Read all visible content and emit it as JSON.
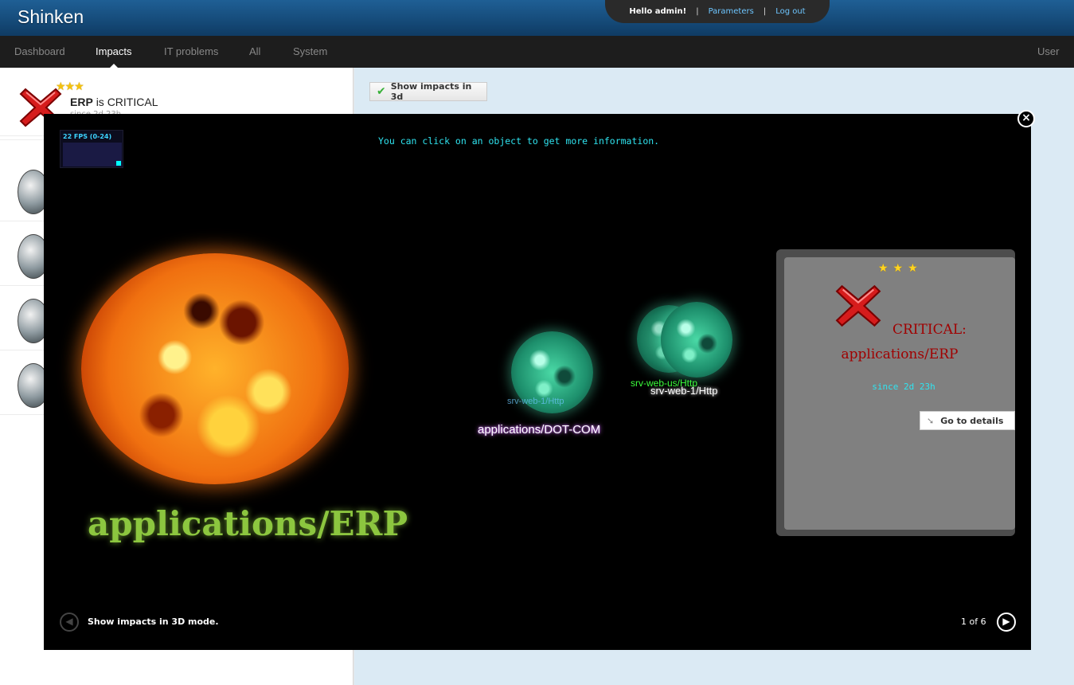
{
  "header": {
    "app_title": "Shinken",
    "greeting": "Hello admin!",
    "separator": "|",
    "parameters_link": "Parameters",
    "logout_link": "Log out"
  },
  "nav": {
    "items": [
      {
        "label": "Dashboard"
      },
      {
        "label": "Impacts",
        "active": true
      },
      {
        "label": "IT problems"
      },
      {
        "label": "All"
      },
      {
        "label": "System"
      }
    ],
    "user": "User"
  },
  "impact": {
    "name": "ERP",
    "state_text": "is CRITICAL",
    "since": "since 2d 23h",
    "stars": "★★★"
  },
  "toolbar": {
    "show3d_label": "Show impacts in 3d"
  },
  "viewer": {
    "fps": "22 FPS (0-24)",
    "hint": "You can click on an object to get more information.",
    "main_label": "applications/ERP",
    "planets": [
      {
        "label": "applications/DOT-COM",
        "sub": "srv-web-1/Http"
      },
      {
        "label_green": "srv-web-us/Http",
        "label_white": "srv-web-1/Http"
      }
    ],
    "info": {
      "stars": "★★★",
      "critical_line1": "CRITICAL:",
      "critical_line2": "applications/ERP",
      "since": "since 2d 23h",
      "details_button": "Go to details"
    },
    "caption": "Show impacts in 3D mode.",
    "pager": "1 of 6"
  },
  "colors": {
    "header_blue": "#1a5588",
    "critical_red": "#a00000",
    "hint_cyan": "#2fe4f0",
    "erp_green": "#8cc63f"
  }
}
